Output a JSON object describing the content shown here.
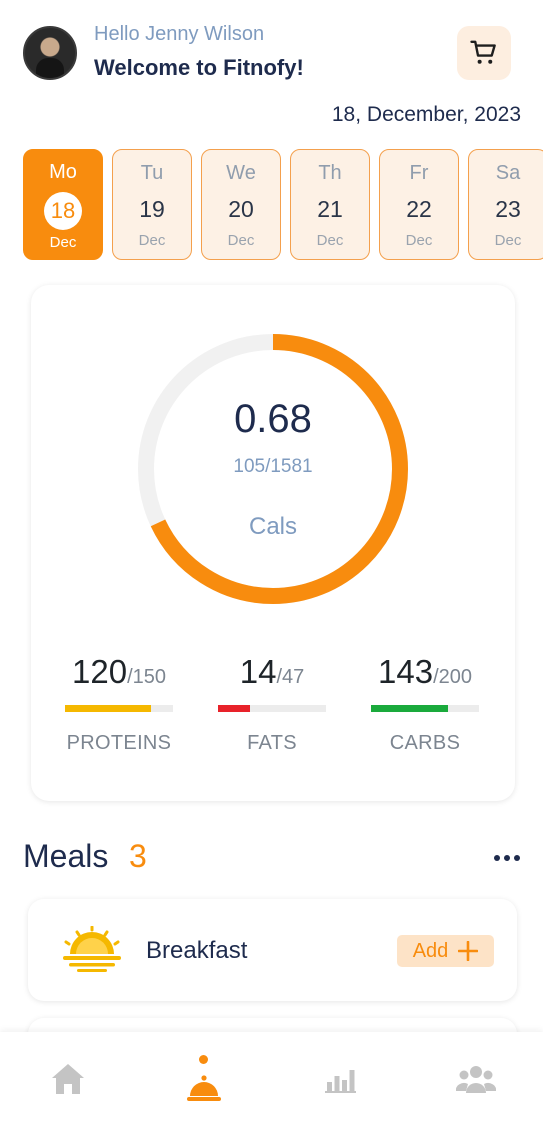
{
  "header": {
    "greeting": "Hello Jenny Wilson",
    "welcome": "Welcome to Fitnofy!",
    "date": "18, December, 2023"
  },
  "week": [
    {
      "day": "Mo",
      "num": "18",
      "month": "Dec",
      "active": true
    },
    {
      "day": "Tu",
      "num": "19",
      "month": "Dec"
    },
    {
      "day": "We",
      "num": "20",
      "month": "Dec"
    },
    {
      "day": "Th",
      "num": "21",
      "month": "Dec"
    },
    {
      "day": "Fr",
      "num": "22",
      "month": "Dec"
    },
    {
      "day": "Sa",
      "num": "23",
      "month": "Dec"
    }
  ],
  "calories": {
    "value": "0.68",
    "ratio": "105/1581",
    "unit": "Cals",
    "progress": 0.68
  },
  "macros": [
    {
      "amount": "120",
      "total": "/150",
      "label": "PROTEINS",
      "fraction": 0.8,
      "color": "#f5b800"
    },
    {
      "amount": "14",
      "total": "/47",
      "label": "FATS",
      "fraction": 0.3,
      "color": "#e8222a"
    },
    {
      "amount": "143",
      "total": "/200",
      "label": "CARBS",
      "fraction": 0.715,
      "color": "#1aaa3c"
    }
  ],
  "meals": {
    "title": "Meals",
    "count": "3",
    "items": [
      {
        "name": "Breakfast",
        "add_label": "Add",
        "icon": "sunrise-icon"
      }
    ]
  },
  "nav": {
    "items": [
      "home-icon",
      "meal-cloche-icon",
      "bar-chart-icon",
      "group-icon"
    ],
    "active_index": 1
  },
  "colors": {
    "accent": "#f88c0e",
    "text_dark": "#1e2b4d",
    "text_muted": "#7f9bbf"
  }
}
